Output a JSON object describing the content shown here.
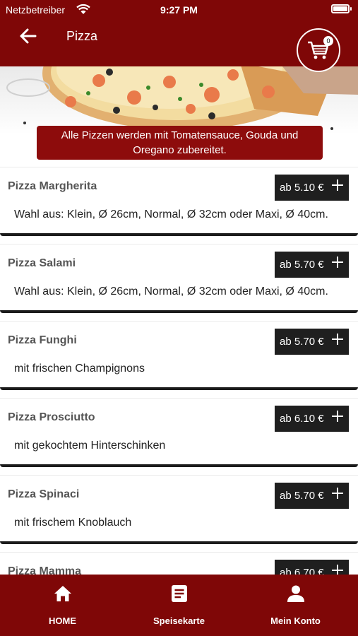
{
  "status_bar": {
    "carrier": "Netzbetreiber",
    "time": "9:27 PM"
  },
  "header": {
    "title": "Pizza",
    "cart_count": "0"
  },
  "banner": {
    "text": "Alle Pizzen werden mit Tomatensauce, Gouda und Oregano zubereitet."
  },
  "menu": {
    "items": [
      {
        "name": "Pizza Margherita",
        "price": "ab 5.10 €",
        "description": "Wahl aus: Klein, Ø 26cm, Normal, Ø 32cm oder Maxi, Ø 40cm."
      },
      {
        "name": "Pizza Salami",
        "price": "ab 5.70 €",
        "description": "Wahl aus: Klein, Ø 26cm, Normal, Ø 32cm oder Maxi, Ø 40cm."
      },
      {
        "name": "Pizza Funghi",
        "price": "ab 5.70 €",
        "description": "mit frischen Champignons"
      },
      {
        "name": "Pizza Prosciutto",
        "price": "ab 6.10 €",
        "description": "mit gekochtem Hinterschinken"
      },
      {
        "name": "Pizza Spinaci",
        "price": "ab 5.70 €",
        "description": "mit frischem Knoblauch"
      },
      {
        "name": "Pizza Mamma",
        "price": "ab 6.70 €",
        "description": ""
      }
    ]
  },
  "bottom_nav": [
    {
      "label": "HOME",
      "icon": "home-icon"
    },
    {
      "label": "Speisekarte",
      "icon": "menu-card-icon"
    },
    {
      "label": "Mein Konto",
      "icon": "account-icon"
    }
  ],
  "colors": {
    "brand": "#7f0707",
    "price_button": "#1f1f1f"
  }
}
